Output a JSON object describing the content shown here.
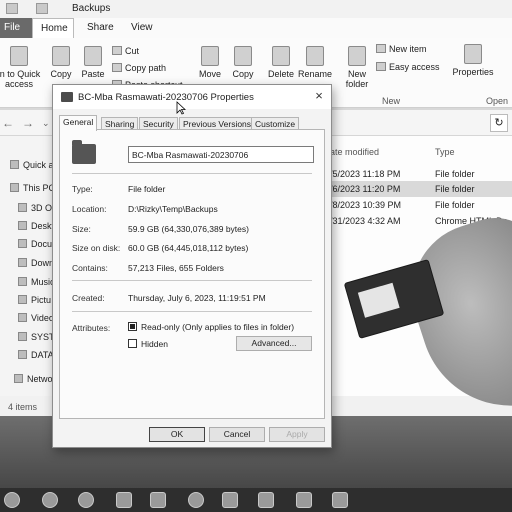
{
  "explorer": {
    "window_title": "Backups",
    "tabs": [
      "File",
      "Home",
      "Share",
      "View"
    ],
    "ribbon": {
      "pin_label": "in to Quick access",
      "copy": "Copy",
      "paste": "Paste",
      "cut": "Cut",
      "copy_path": "Copy path",
      "paste_shortcut": "Paste shortcut",
      "move_to": "Move",
      "copy_to": "Copy",
      "delete": "Delete",
      "rename": "Rename",
      "new_folder": "New folder",
      "new_item": "New item",
      "easy_access": "Easy access",
      "new_group": "New",
      "properties": "Properties",
      "open_group": "Open"
    },
    "nav_pane": [
      "Quick a",
      "This PC",
      "3D Ob",
      "Deskt",
      "Docu",
      "Down",
      "Music",
      "Pictu",
      "Video",
      "SYSTE",
      "DATA",
      "Netwo"
    ],
    "columns": {
      "date": "ate modified",
      "type": "Type"
    },
    "rows": [
      {
        "date": "/5/2023 11:18 PM",
        "type": "File folder",
        "selected": false
      },
      {
        "date": "/6/2023 11:20 PM",
        "type": "File folder",
        "selected": true
      },
      {
        "date": "/8/2023 10:39 PM",
        "type": "File folder",
        "selected": false
      },
      {
        "date": "/31/2023 4:32 AM",
        "type": "Chrome HTML Do",
        "selected": false
      }
    ],
    "status": "4 items"
  },
  "dialog": {
    "title": "BC-Mba Rasmawati-20230706 Properties",
    "tabs": [
      "General",
      "Sharing",
      "Security",
      "Previous Versions",
      "Customize"
    ],
    "name": "BC-Mba Rasmawati-20230706",
    "type_label": "Type:",
    "type_value": "File folder",
    "location_label": "Location:",
    "location_value": "D:\\Rizky\\Temp\\Backups",
    "size_label": "Size:",
    "size_value": "59.9 GB (64,330,076,389 bytes)",
    "size_on_disk_label": "Size on disk:",
    "size_on_disk_value": "60.0 GB (64,445,018,112 bytes)",
    "contains_label": "Contains:",
    "contains_value": "57,213 Files, 655 Folders",
    "created_label": "Created:",
    "created_value": "Thursday, July 6, 2023, 11:19:51 PM",
    "attributes_label": "Attributes:",
    "readonly_label": "Read-only (Only applies to files in folder)",
    "readonly_checked": true,
    "hidden_label": "Hidden",
    "hidden_checked": false,
    "advanced_label": "Advanced...",
    "ok": "OK",
    "cancel": "Cancel",
    "apply": "Apply",
    "close_glyph": "×"
  }
}
